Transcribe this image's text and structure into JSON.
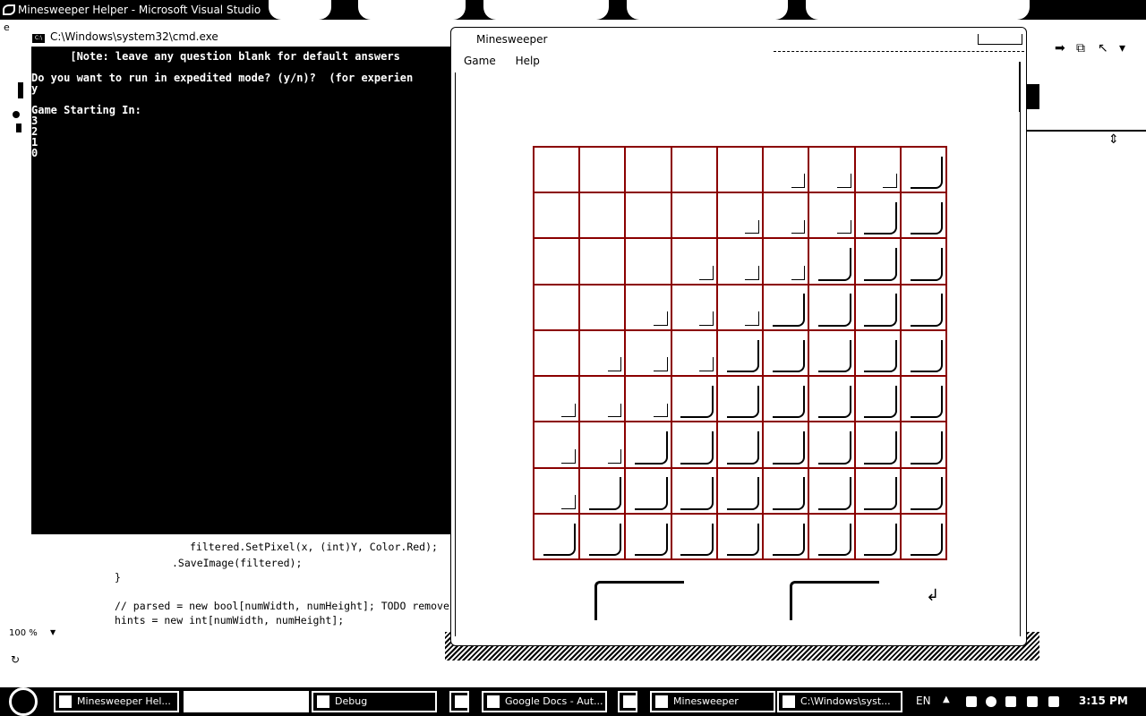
{
  "vs": {
    "title": "Minesweeper Helper - Microsoft Visual Studio",
    "menu_letter": "e",
    "zoom": "100 %"
  },
  "code": {
    "lines": [
      "filtered.SetPixel(x, (int)Y, Color.Red);",
      ".SaveImage(filtered);",
      "}",
      "// parsed = new bool[numWidth, numHeight]; TODO remove",
      "hints = new int[numWidth, numHeight];"
    ]
  },
  "cmd": {
    "title": "C:\\Windows\\system32\\cmd.exe",
    "lines": [
      "      [Note: leave any question blank for default answers",
      "",
      "Do you want to run in expedited mode? (y/n)?  (for experien",
      "y",
      "",
      "Game Starting In:",
      "3",
      "2",
      "1",
      "0"
    ]
  },
  "minesweeper": {
    "title": "Minesweeper",
    "menu": [
      "Game",
      "Help"
    ],
    "rows": 9,
    "cols": 9,
    "grid_color": "#8b0000"
  },
  "taskbar": {
    "items": [
      {
        "label": "Minesweeper Hel...",
        "blank": false
      },
      {
        "label": "",
        "blank": true
      },
      {
        "label": "Debug",
        "blank": false
      },
      {
        "label": "",
        "blank": false
      },
      {
        "label": "Google Docs - Aut...",
        "blank": false
      },
      {
        "label": "",
        "blank": false
      },
      {
        "label": "Minesweeper",
        "blank": false
      },
      {
        "label": "C:\\Windows\\syst...",
        "blank": false
      }
    ],
    "language": "EN",
    "time": "3:15 PM"
  }
}
